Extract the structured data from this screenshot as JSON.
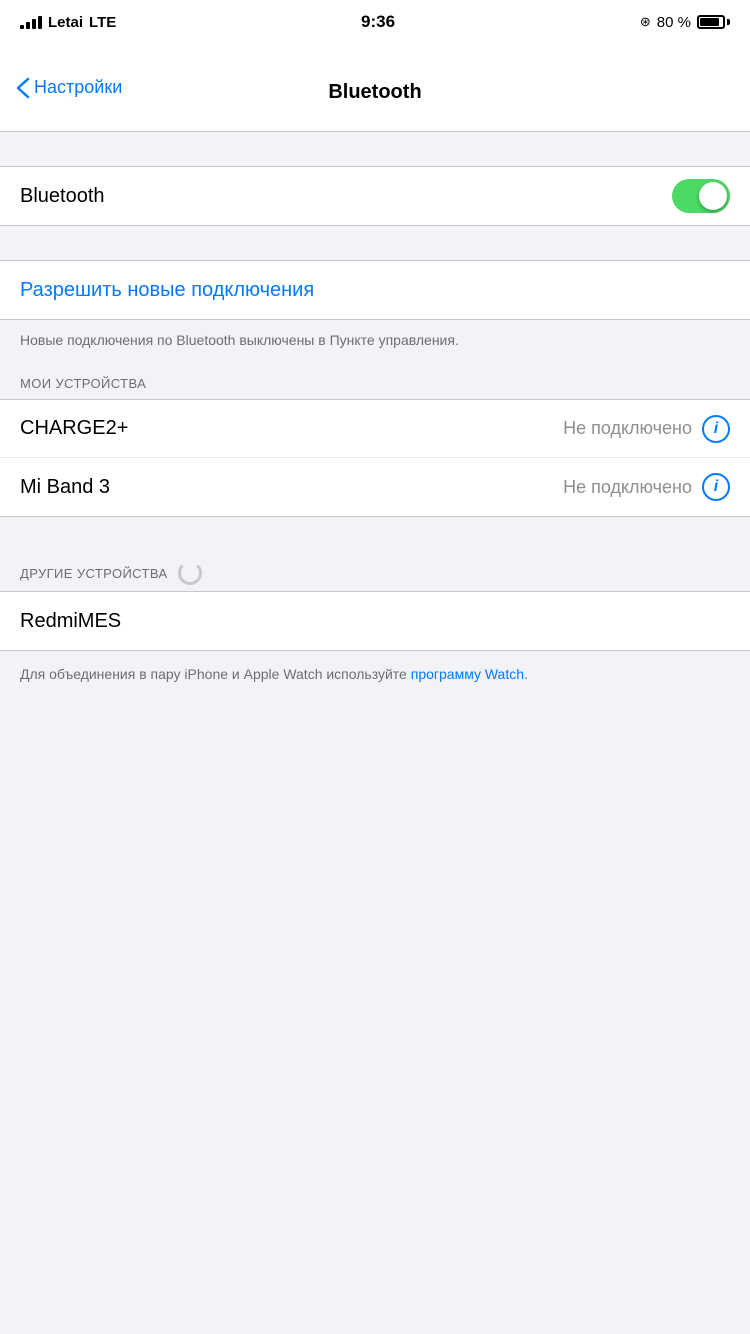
{
  "statusBar": {
    "carrier": "Letai",
    "networkType": "LTE",
    "time": "9:36",
    "batteryPercent": "80 %"
  },
  "navBar": {
    "backLabel": "Настройки",
    "title": "Bluetooth"
  },
  "bluetoothSection": {
    "label": "Bluetooth",
    "enabled": true
  },
  "newConnections": {
    "linkLabel": "Разрешить новые подключения",
    "infoText": "Новые подключения по Bluetooth выключены в Пункте управления."
  },
  "myDevicesHeader": "МОИ УСТРОЙСТВА",
  "myDevices": [
    {
      "name": "CHARGE2+",
      "status": "Не подключено"
    },
    {
      "name": "Mi Band 3",
      "status": "Не подключено"
    }
  ],
  "otherDevicesHeader": "ДРУГИЕ УСТРОЙСТВА",
  "otherDevices": [
    {
      "name": "RedmiMES"
    }
  ],
  "footer": {
    "textBefore": "Для объединения в пару iPhone и Apple Watch используйте ",
    "linkLabel": "программу Watch",
    "textAfter": "."
  }
}
